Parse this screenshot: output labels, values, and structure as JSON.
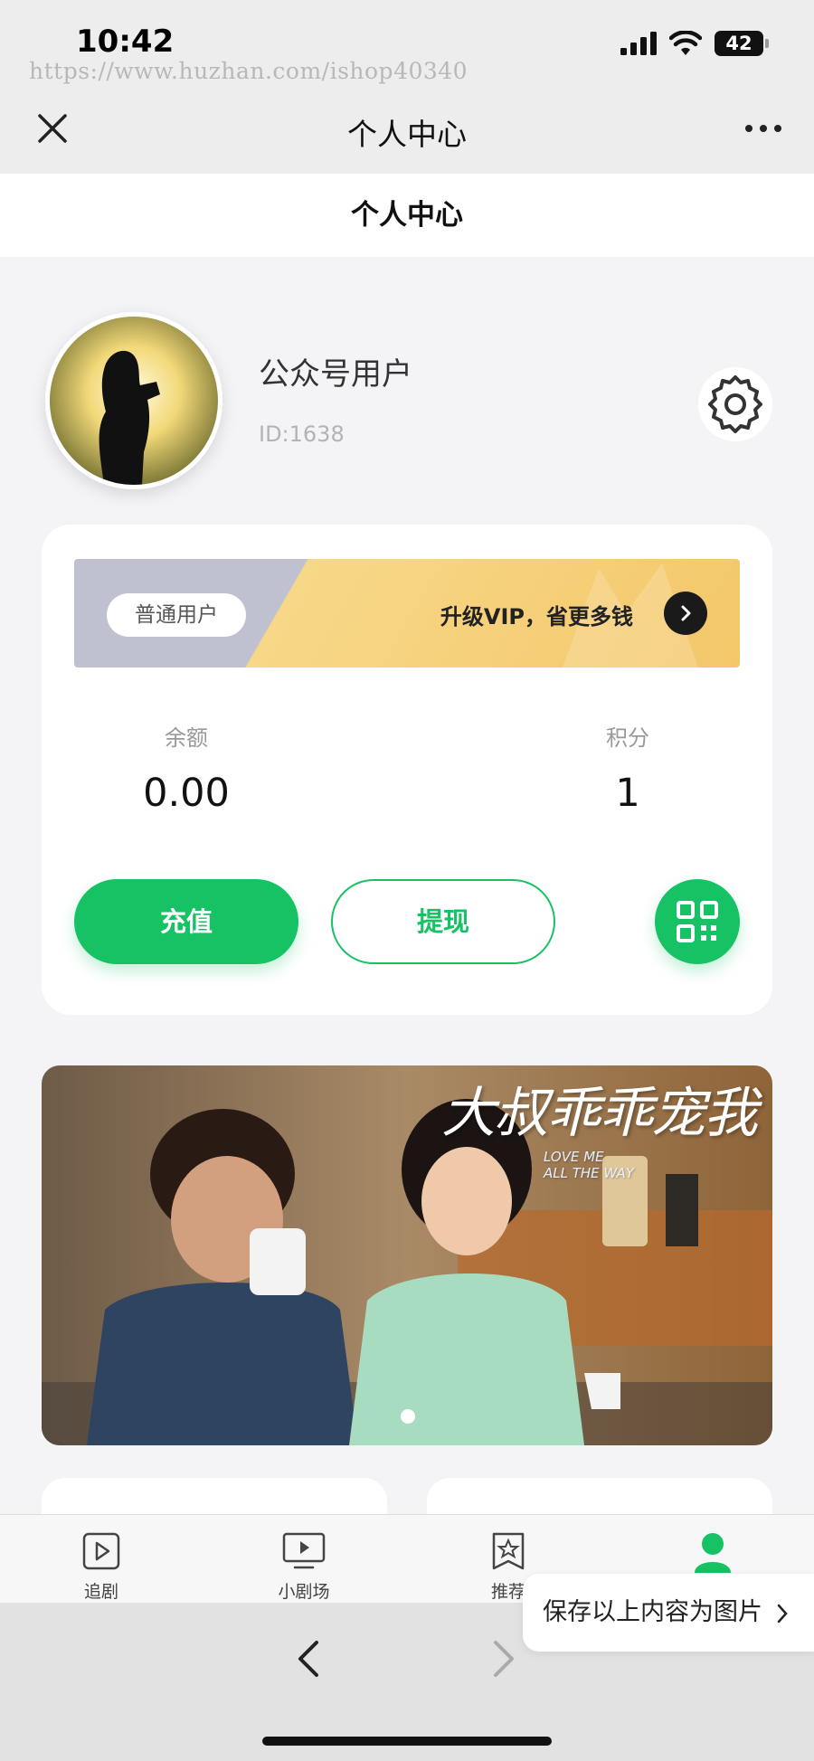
{
  "status_bar": {
    "time": "10:42",
    "watermark": "https://www.huzhan.com/ishop40340",
    "battery": "42"
  },
  "nav": {
    "title": "个人中心"
  },
  "page_header": {
    "title": "个人中心"
  },
  "profile": {
    "username": "公众号用户",
    "user_id": "ID:1638"
  },
  "account": {
    "level_badge": "普通用户",
    "vip_promo": "升级VIP，省更多钱",
    "balance_label": "余额",
    "balance_value": "0.00",
    "points_label": "积分",
    "points_value": "1",
    "recharge_label": "充值",
    "withdraw_label": "提现"
  },
  "promo_banner": {
    "title": "大叔乖乖宠我",
    "subtitle_line1": "LOVE ME",
    "subtitle_line2": "ALL THE WAY",
    "slide_count": 1,
    "active_slide": 1
  },
  "tabbar": {
    "items": [
      {
        "label": "追剧",
        "icon": "play-square-icon"
      },
      {
        "label": "小剧场",
        "icon": "tv-play-icon"
      },
      {
        "label": "推荐",
        "icon": "star-bookmark-icon"
      },
      {
        "label": "",
        "icon": "user-icon"
      }
    ],
    "active_color": "#16c264"
  },
  "save_popup": {
    "label": "保存以上内容为图片"
  },
  "colors": {
    "accent": "#16c264",
    "vip_gold": "#f7d888",
    "level_gray": "#bfc0d0"
  }
}
